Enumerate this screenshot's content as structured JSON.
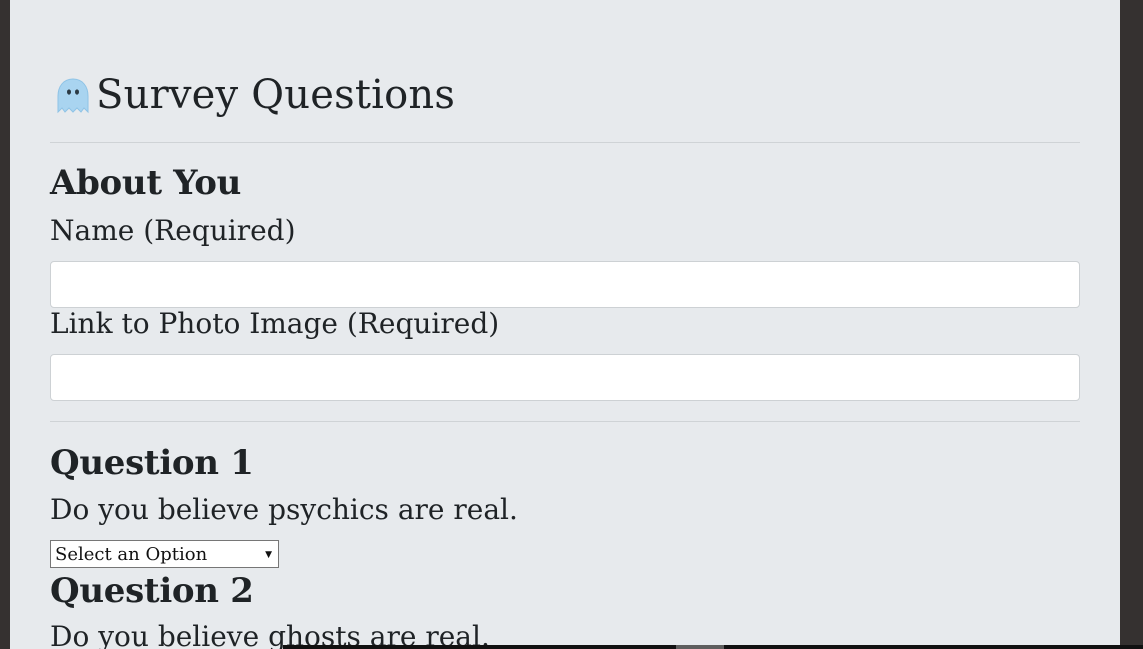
{
  "page": {
    "title": "Survey Questions",
    "icon": "ghost-icon"
  },
  "about_you": {
    "heading": "About You",
    "name_label": "Name (Required)",
    "name_value": "",
    "photo_label": "Link to Photo Image (Required)",
    "photo_value": ""
  },
  "questions": [
    {
      "heading": "Question 1",
      "text": "Do you believe psychics are real.",
      "selected": "Select an Option"
    },
    {
      "heading": "Question 2",
      "text": "Do you believe ghosts are real."
    }
  ],
  "colors": {
    "page_background": "#e7eaed",
    "outer_background": "#353130",
    "text": "#1f2326"
  }
}
